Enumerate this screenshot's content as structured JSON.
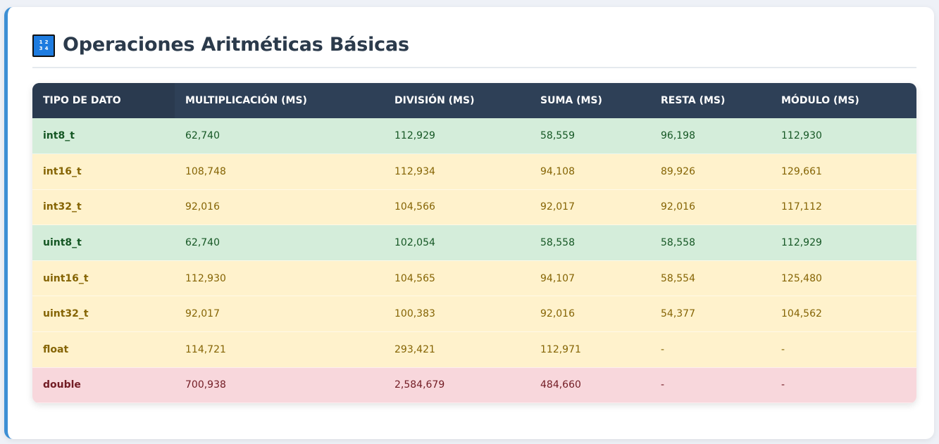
{
  "header": {
    "icon_digits": [
      "1",
      "2",
      "3",
      "4"
    ],
    "title": "Operaciones Aritméticas Básicas"
  },
  "table": {
    "columns": [
      "Tipo de Dato",
      "Multiplicación (ms)",
      "División (ms)",
      "Suma (ms)",
      "Resta (ms)",
      "Módulo (ms)"
    ],
    "rows": [
      {
        "tone": "green",
        "cells": [
          "int8_t",
          "62,740",
          "112,929",
          "58,559",
          "96,198",
          "112,930"
        ]
      },
      {
        "tone": "yellow",
        "cells": [
          "int16_t",
          "108,748",
          "112,934",
          "94,108",
          "89,926",
          "129,661"
        ]
      },
      {
        "tone": "yellow",
        "cells": [
          "int32_t",
          "92,016",
          "104,566",
          "92,017",
          "92,016",
          "117,112"
        ]
      },
      {
        "tone": "green",
        "cells": [
          "uint8_t",
          "62,740",
          "102,054",
          "58,558",
          "58,558",
          "112,929"
        ]
      },
      {
        "tone": "yellow",
        "cells": [
          "uint16_t",
          "112,930",
          "104,565",
          "94,107",
          "58,554",
          "125,480"
        ]
      },
      {
        "tone": "yellow",
        "cells": [
          "uint32_t",
          "92,017",
          "100,383",
          "92,016",
          "54,377",
          "104,562"
        ]
      },
      {
        "tone": "yellow",
        "cells": [
          "float",
          "114,721",
          "293,421",
          "112,971",
          "-",
          "-"
        ]
      },
      {
        "tone": "red",
        "cells": [
          "double",
          "700,938",
          "2,584,679",
          "484,660",
          "-",
          "-"
        ]
      }
    ]
  },
  "colors": {
    "header_bg": "#2e4057",
    "accent_border": "#3d8fd4",
    "green_row": "#d4edda",
    "yellow_row": "#fff2cc",
    "red_row": "#f8d7dc"
  }
}
